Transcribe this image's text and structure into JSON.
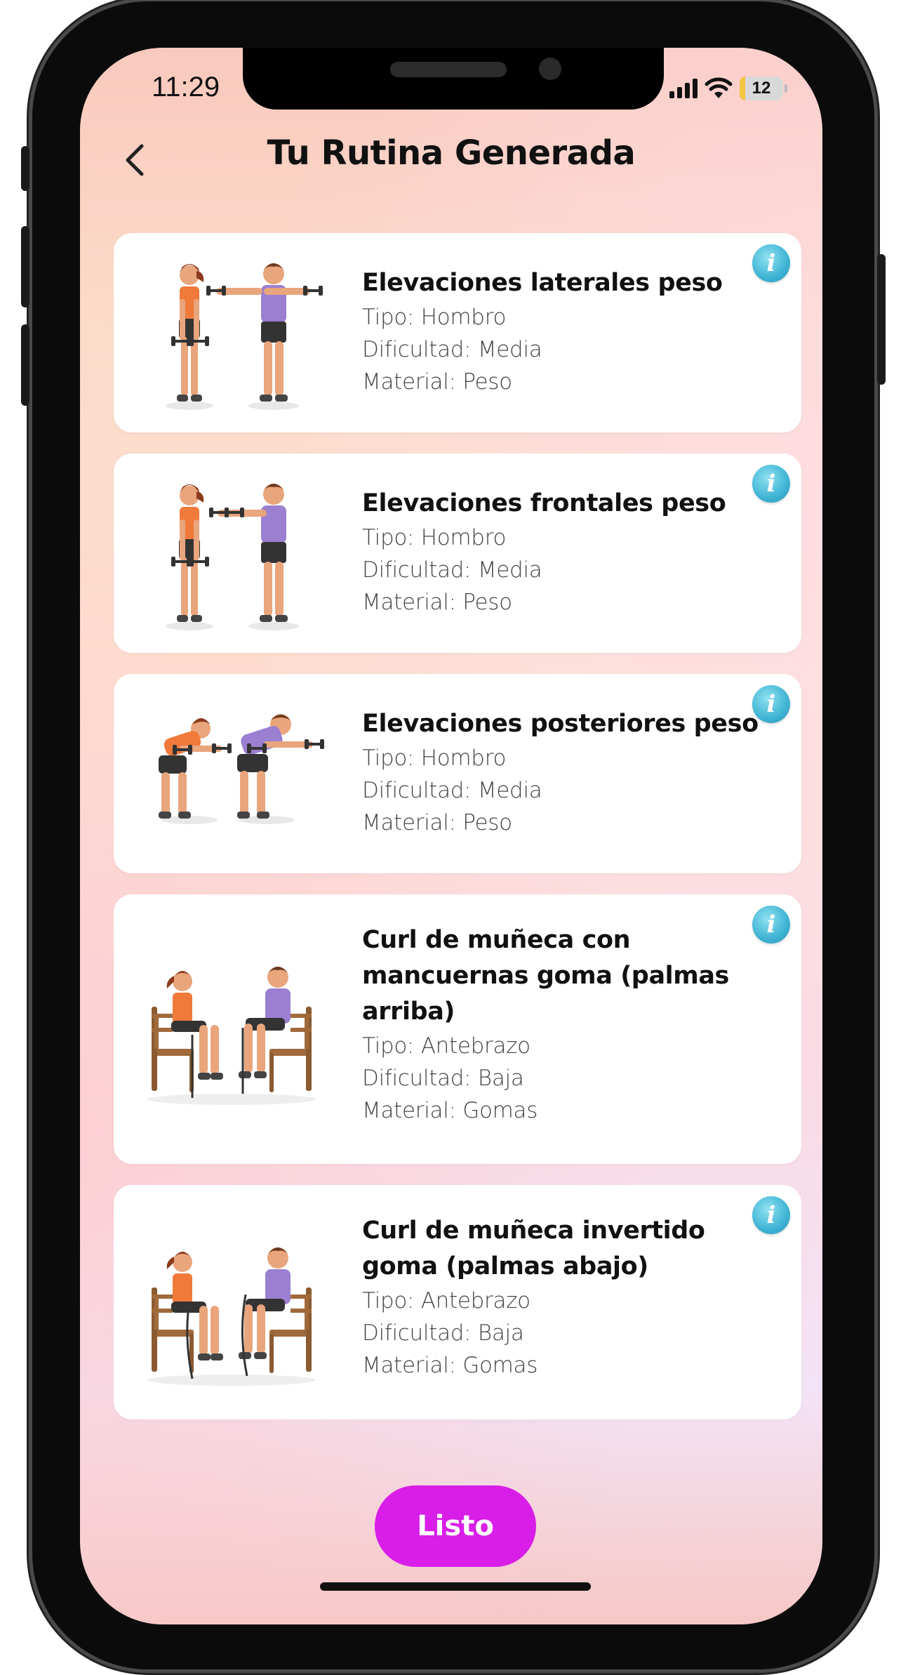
{
  "status_bar": {
    "time": "11:29",
    "battery": "12"
  },
  "header": {
    "title": "Tu Rutina Generada"
  },
  "exercises": [
    {
      "name": "Elevaciones laterales peso",
      "type": "Tipo: Hombro",
      "difficulty": "Dificultad: Media",
      "material": "Material: Peso"
    },
    {
      "name": "Elevaciones frontales peso",
      "type": "Tipo: Hombro",
      "difficulty": "Dificultad: Media",
      "material": "Material: Peso"
    },
    {
      "name": "Elevaciones posteriores peso",
      "type": "Tipo: Hombro",
      "difficulty": "Dificultad: Media",
      "material": "Material: Peso"
    },
    {
      "name": "Curl de muñeca con mancuernas goma (palmas arriba)",
      "type": "Tipo: Antebrazo",
      "difficulty": "Dificultad: Baja",
      "material": "Material: Gomas"
    },
    {
      "name": "Curl de muñeca invertido goma (palmas abajo)",
      "type": "Tipo: Antebrazo",
      "difficulty": "Dificultad: Baja",
      "material": "Material: Gomas"
    }
  ],
  "footer": {
    "done_label": "Listo"
  },
  "colors": {
    "accent": "#d81ee8",
    "info": "#3fb4d4",
    "woman_top": "#f07a3a",
    "man_top": "#9b7fd1"
  }
}
